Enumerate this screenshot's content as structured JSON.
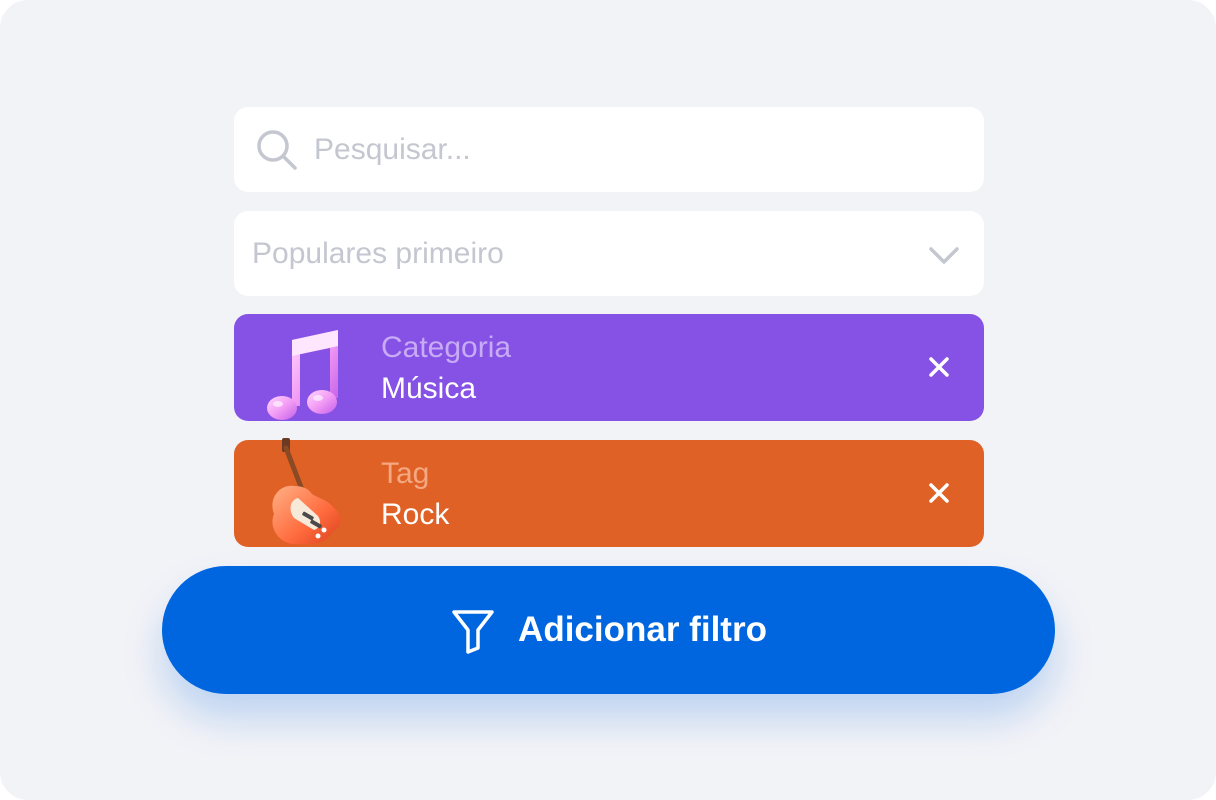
{
  "search": {
    "placeholder": "Pesquisar...",
    "icon": "search-icon"
  },
  "sort": {
    "value": "Populares primeiro",
    "icon": "chevron-down-icon"
  },
  "filters": [
    {
      "label": "Categoria",
      "value": "Música",
      "color": "#8652e6",
      "label_color": "#c8aaf5",
      "icon": "music-note-icon"
    },
    {
      "label": "Tag",
      "value": "Rock",
      "color": "#e06126",
      "label_color": "#f4a882",
      "icon": "electric-guitar-icon"
    }
  ],
  "cta": {
    "label": "Adicionar filtro",
    "icon": "filter-funnel-icon",
    "color": "#0066e0"
  },
  "colors": {
    "background": "#f2f3f7",
    "field": "#ffffff",
    "placeholder": "#c4c6d0"
  }
}
